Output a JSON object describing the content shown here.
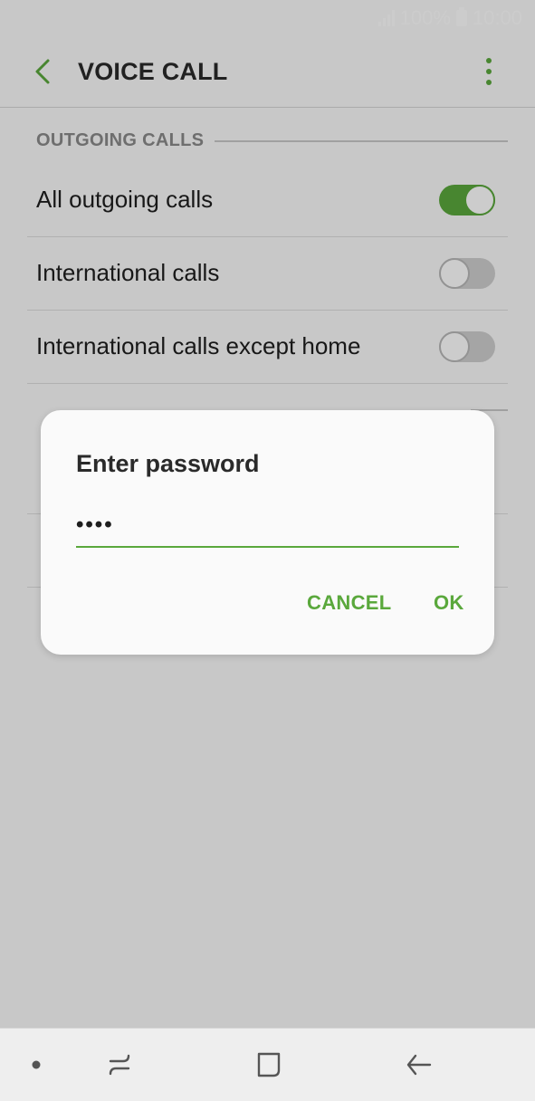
{
  "status_bar": {
    "battery": "100%",
    "time": "10:00"
  },
  "app_bar": {
    "title": "VOICE CALL",
    "back_icon": "chevron-left-icon",
    "more_icon": "more-vertical-icon"
  },
  "sections": [
    {
      "header": "OUTGOING CALLS",
      "items": [
        {
          "label": "All outgoing calls",
          "on": true
        },
        {
          "label": "International calls",
          "on": false
        },
        {
          "label": "International calls except home",
          "on": false
        }
      ]
    }
  ],
  "dialog": {
    "title": "Enter password",
    "password_value": "••••",
    "cancel_label": "CANCEL",
    "ok_label": "OK"
  },
  "nav_bar": {
    "icons": [
      "dot-icon",
      "recent-apps-icon",
      "home-icon",
      "back-icon"
    ]
  },
  "colors": {
    "accent": "#5aa83c",
    "background": "#fafafa",
    "toggle_off": "#cfcfcf"
  }
}
